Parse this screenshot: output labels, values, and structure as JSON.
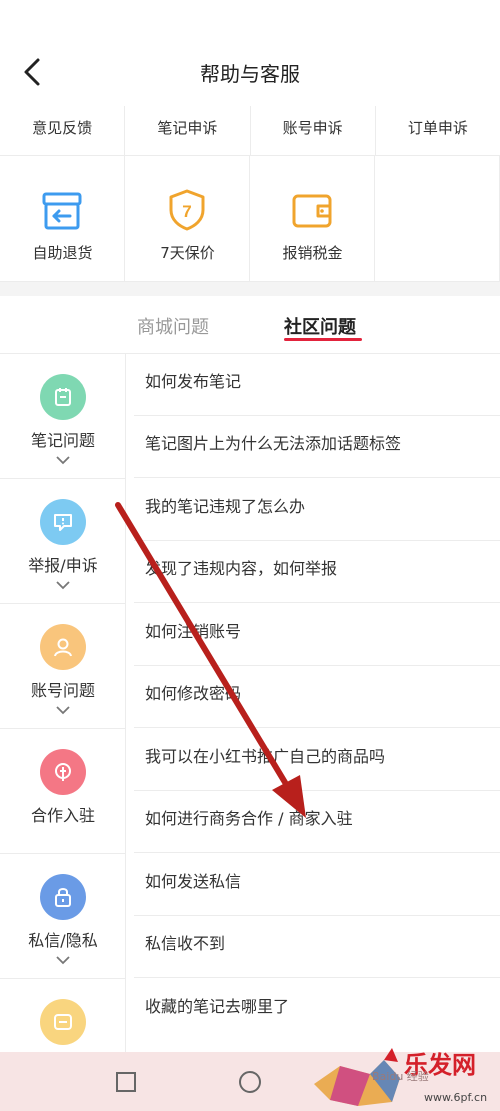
{
  "header": {
    "title": "帮助与客服"
  },
  "quick_links": [
    "意见反馈",
    "笔记申诉",
    "账号申诉",
    "订单申诉"
  ],
  "tools": [
    {
      "label": "自助退货",
      "icon": "return-box-icon",
      "color": "#3d9bef"
    },
    {
      "label": "7天保价",
      "icon": "shield-7-icon",
      "color": "#f0a42d",
      "badge": "7"
    },
    {
      "label": "报销税金",
      "icon": "wallet-icon",
      "color": "#f0a42d"
    }
  ],
  "tabs": {
    "inactive": "商城问题",
    "active": "社区问题",
    "accent": "#e2233c"
  },
  "categories": [
    {
      "label": "笔记问题",
      "icon": "note-icon",
      "color": "#7fd8b2"
    },
    {
      "label": "举报/申诉",
      "icon": "report-icon",
      "color": "#7dcaf2"
    },
    {
      "label": "账号问题",
      "icon": "account-icon",
      "color": "#f9c57c"
    },
    {
      "label": "合作入驻",
      "icon": "cooperation-icon",
      "color": "#f47785"
    },
    {
      "label": "私信/隐私",
      "icon": "lock-icon",
      "color": "#6a9be6"
    },
    {
      "label": "",
      "icon": "favorites-icon",
      "color": "#f9d57f"
    }
  ],
  "questions": [
    "如何发布笔记",
    "笔记图片上为什么无法添加话题标签",
    "我的笔记违规了怎么办",
    "发现了违规内容，如何举报",
    "如何注销账号",
    "如何修改密码",
    "我可以在小红书推广自己的商品吗",
    "如何进行商务合作 / 商家入驻",
    "如何发送私信",
    "私信收不到",
    "收藏的笔记去哪里了"
  ],
  "watermark": {
    "text": "乐发网",
    "url": "www.6pf.cn",
    "baidu": "Baidu 经验"
  },
  "colors": {
    "arrow": "#b8201c",
    "navbar": "#f7e4e4"
  }
}
